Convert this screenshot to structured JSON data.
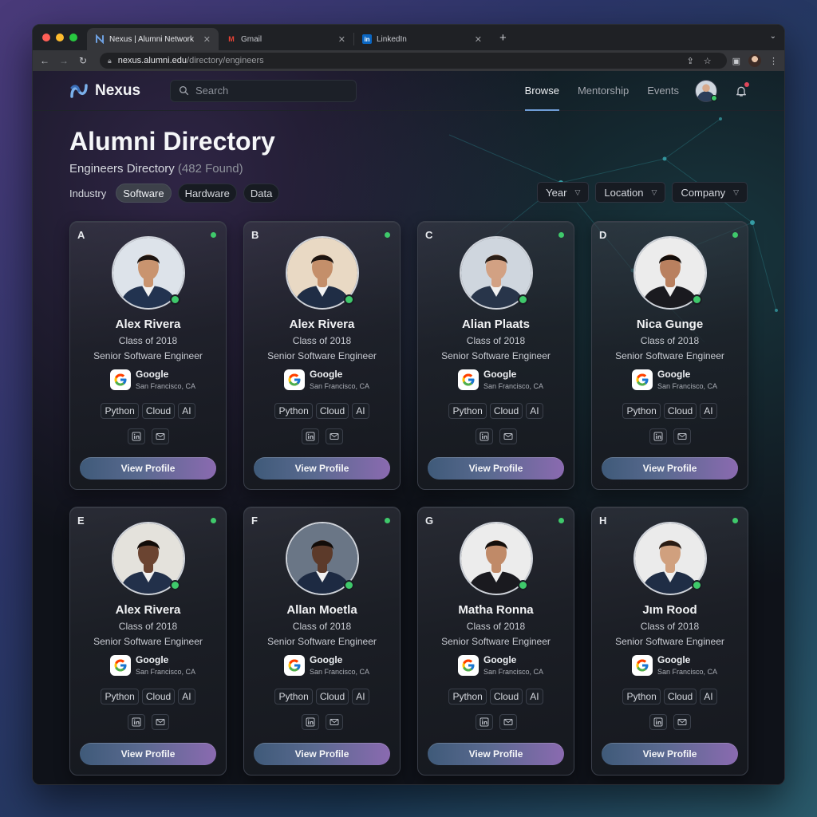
{
  "browser": {
    "tabs": [
      {
        "title": "Nexus | Alumni Network",
        "icon": "nexus-logo-icon"
      },
      {
        "title": "Gmail",
        "icon": "gmail-icon"
      },
      {
        "title": "LinkedIn",
        "icon": "linkedin-icon"
      }
    ],
    "url_host": "nexus.alumni.edu",
    "url_path": "/directory/engineers"
  },
  "app": {
    "brand": "Nexus",
    "search_placeholder": "Search",
    "nav": [
      {
        "label": "Browse",
        "active": true
      },
      {
        "label": "Mentorship",
        "active": false
      },
      {
        "label": "Events",
        "active": false
      }
    ]
  },
  "page": {
    "title": "Alumni Directory",
    "subtitle": "Engineers Directory",
    "count": "(482 Found)",
    "filter_label": "Industry",
    "chips": [
      {
        "label": "Software",
        "active": true
      },
      {
        "label": "Hardware",
        "active": false
      },
      {
        "label": "Data",
        "active": false
      }
    ],
    "dropdowns": [
      "Year",
      "Location",
      "Company"
    ]
  },
  "cards": [
    {
      "letter": "A",
      "name": "Alex Rivera",
      "class_year": "Class of 2018",
      "role": "Senior Software Engineer",
      "company": "Google",
      "location": "San Francisco, CA",
      "tags": [
        "Python",
        "Cloud",
        "AI"
      ],
      "button": "View Profile",
      "skin": "#c9946f",
      "hair": "#1c1410",
      "suit": "#223350",
      "bg": "#dde3ea"
    },
    {
      "letter": "B",
      "name": "Alex Rivera",
      "class_year": "Class of 2018",
      "role": "Senior Software Engineer",
      "company": "Google",
      "location": "San Francisco, CA",
      "tags": [
        "Python",
        "Cloud",
        "AI"
      ],
      "button": "View Profile",
      "skin": "#c48f6a",
      "hair": "#1c1410",
      "suit": "#1f2d45",
      "bg": "#e9d9c4"
    },
    {
      "letter": "C",
      "name": "Alian Plaats",
      "class_year": "Class of 2018",
      "role": "Senior Software Engineer",
      "company": "Google",
      "location": "San Francisco, CA",
      "tags": [
        "Python",
        "Cloud",
        "AI"
      ],
      "button": "View Profile",
      "skin": "#d2a183",
      "hair": "#2a1e17",
      "suit": "#28354a",
      "bg": "#cfd6de"
    },
    {
      "letter": "D",
      "name": "Nica Gunge",
      "class_year": "Class of 2018",
      "role": "Senior Software Engineer",
      "company": "Google",
      "location": "San Francisco, CA",
      "tags": [
        "Python",
        "Cloud",
        "AI"
      ],
      "button": "View Profile",
      "skin": "#b9805f",
      "hair": "#120c09",
      "suit": "#1a1a1f",
      "bg": "#ececec"
    },
    {
      "letter": "E",
      "name": "Alex Rivera",
      "class_year": "Class of 2018",
      "role": "Senior Software Engineer",
      "company": "Google",
      "location": "San Francisco, CA",
      "tags": [
        "Python",
        "Cloud",
        "AI"
      ],
      "button": "View Profile",
      "skin": "#6b4431",
      "hair": "#120c09",
      "suit": "#22304a",
      "bg": "#e4e2dc"
    },
    {
      "letter": "F",
      "name": "Allan Moetla",
      "class_year": "Class of 2018",
      "role": "Senior Software Engineer",
      "company": "Google",
      "location": "San Francisco, CA",
      "tags": [
        "Python",
        "Cloud",
        "AI"
      ],
      "button": "View Profile",
      "skin": "#5c3a2a",
      "hair": "#120c09",
      "suit": "#1d2a42",
      "bg": "#6a7686"
    },
    {
      "letter": "G",
      "name": "Matha Ronna",
      "class_year": "Class of 2018",
      "role": "Senior Software Engineer",
      "company": "Google",
      "location": "San Francisco, CA",
      "tags": [
        "Python",
        "Cloud",
        "AI"
      ],
      "button": "View Profile",
      "skin": "#c08a68",
      "hair": "#140e0b",
      "suit": "#1a1a1f",
      "bg": "#ececec"
    },
    {
      "letter": "H",
      "name": "Jιm Rood",
      "class_year": "Class of 2018",
      "role": "Senior Software Engineer",
      "company": "Google",
      "location": "San Francisco, CA",
      "tags": [
        "Python",
        "Cloud",
        "AI"
      ],
      "button": "View Profile",
      "skin": "#d0a07e",
      "hair": "#2a1c14",
      "suit": "#1f2d45",
      "bg": "#ebebeb"
    }
  ]
}
